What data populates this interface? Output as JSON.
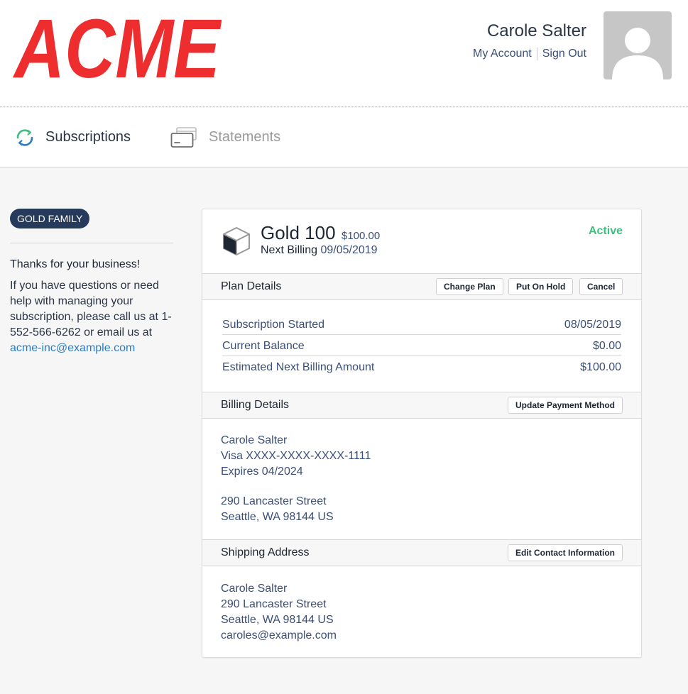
{
  "brand": {
    "logo_text": "ACME",
    "logo_color": "#ee2d2f"
  },
  "user": {
    "name": "Carole Salter",
    "my_account_label": "My Account",
    "sign_out_label": "Sign Out"
  },
  "tabs": [
    {
      "label": "Subscriptions",
      "icon": "refresh-icon",
      "active": true
    },
    {
      "label": "Statements",
      "icon": "card-stack-icon",
      "active": false
    }
  ],
  "sidebar": {
    "badge": "GOLD FAMILY",
    "thanks": "Thanks for your business!",
    "help_line_1": "If you have questions or need",
    "help_line_2": "help with managing your",
    "help_line_3": "subscription, please call us at 1-",
    "help_line_4": "552-566-6262 or email us at",
    "email": "acme-inc@example.com"
  },
  "subscription": {
    "plan_name": "Gold 100",
    "price": "$100.00",
    "next_billing_label": "Next Billing",
    "next_billing_date": "09/05/2019",
    "status": "Active",
    "status_color": "#3fbf7f",
    "plan_details": {
      "title": "Plan Details",
      "buttons": {
        "change_plan": "Change Plan",
        "put_on_hold": "Put On Hold",
        "cancel": "Cancel"
      },
      "rows": [
        {
          "label": "Subscription Started",
          "value": "08/05/2019"
        },
        {
          "label": "Current Balance",
          "value": "$0.00"
        },
        {
          "label": "Estimated Next Billing Amount",
          "value": "$100.00"
        }
      ]
    },
    "billing_details": {
      "title": "Billing Details",
      "button": "Update Payment Method",
      "name": "Carole Salter",
      "card": "Visa XXXX-XXXX-XXXX-1111",
      "expires": "Expires 04/2024",
      "street": "290 Lancaster Street",
      "city": "Seattle, WA 98144 US"
    },
    "shipping_address": {
      "title": "Shipping Address",
      "button": "Edit Contact Information",
      "name": "Carole Salter",
      "street": "290 Lancaster Street",
      "city": "Seattle, WA 98144 US",
      "email": "caroles@example.com"
    }
  }
}
